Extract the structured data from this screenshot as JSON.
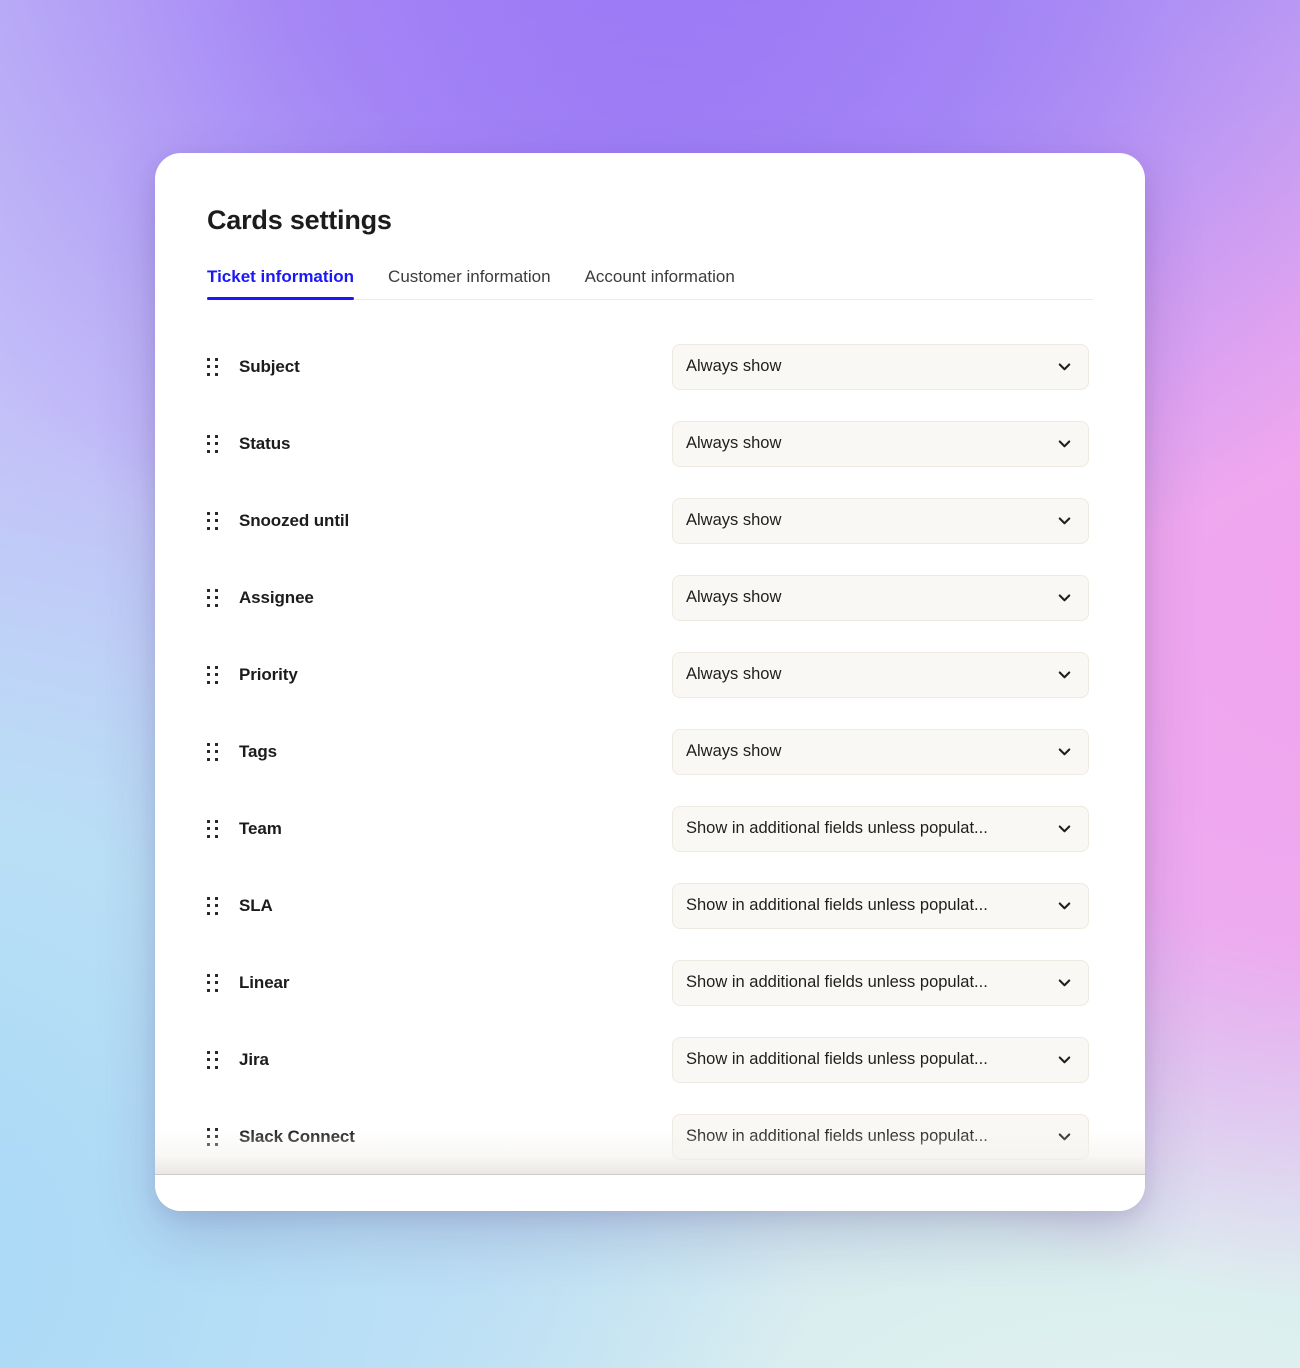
{
  "header": {
    "title": "Cards settings"
  },
  "tabs": [
    {
      "label": "Ticket information",
      "active": true
    },
    {
      "label": "Customer information",
      "active": false
    },
    {
      "label": "Account information",
      "active": false
    }
  ],
  "options": {
    "always_show": "Always show",
    "show_additional": "Show in additional fields unless populat..."
  },
  "fields": [
    {
      "label": "Subject",
      "value": "Always show",
      "drag_handle": "drag-handle-icon",
      "chevron": "chevron-down-icon"
    },
    {
      "label": "Status",
      "value": "Always show",
      "drag_handle": "drag-handle-icon",
      "chevron": "chevron-down-icon"
    },
    {
      "label": "Snoozed until",
      "value": "Always show",
      "drag_handle": "drag-handle-icon",
      "chevron": "chevron-down-icon"
    },
    {
      "label": "Assignee",
      "value": "Always show",
      "drag_handle": "drag-handle-icon",
      "chevron": "chevron-down-icon"
    },
    {
      "label": "Priority",
      "value": "Always show",
      "drag_handle": "drag-handle-icon",
      "chevron": "chevron-down-icon"
    },
    {
      "label": "Tags",
      "value": "Always show",
      "drag_handle": "drag-handle-icon",
      "chevron": "chevron-down-icon"
    },
    {
      "label": "Team",
      "value": "Show in additional fields unless populat...",
      "drag_handle": "drag-handle-icon",
      "chevron": "chevron-down-icon"
    },
    {
      "label": "SLA",
      "value": "Show in additional fields unless populat...",
      "drag_handle": "drag-handle-icon",
      "chevron": "chevron-down-icon"
    },
    {
      "label": "Linear",
      "value": "Show in additional fields unless populat...",
      "drag_handle": "drag-handle-icon",
      "chevron": "chevron-down-icon"
    },
    {
      "label": "Jira",
      "value": "Show in additional fields unless populat...",
      "drag_handle": "drag-handle-icon",
      "chevron": "chevron-down-icon"
    },
    {
      "label": "Slack Connect",
      "value": "Show in additional fields unless populat...",
      "drag_handle": "drag-handle-icon",
      "chevron": "chevron-down-icon"
    }
  ],
  "colors": {
    "accent": "#1a18fa",
    "card_bg": "#ffffff",
    "select_bg": "#faf8f4",
    "select_border": "#eeeae1",
    "text": "#1c1c1c",
    "divider": "#f0ece5",
    "bg_purple": "#9b76f6",
    "bg_pink": "#efa6ec",
    "bg_blue": "#b8ddf5",
    "bg_mint": "#dcefef"
  }
}
